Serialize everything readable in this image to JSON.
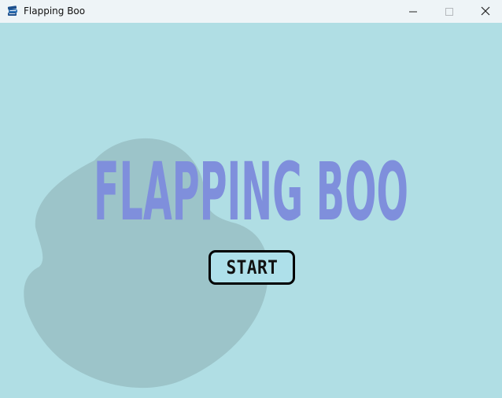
{
  "window": {
    "title": "Flapping Boo",
    "icon": "book-stack-icon",
    "controls": [
      "minimize-icon",
      "maximize-icon",
      "close-icon"
    ]
  },
  "game": {
    "title": "FLAPPING BOO",
    "start_label": "START",
    "colors": {
      "background": "#b0dee4",
      "title": "#7f8fdc",
      "ghost_silhouette": "#99bfc4",
      "button_fill": "#aee0ea",
      "button_border": "#000000"
    }
  }
}
